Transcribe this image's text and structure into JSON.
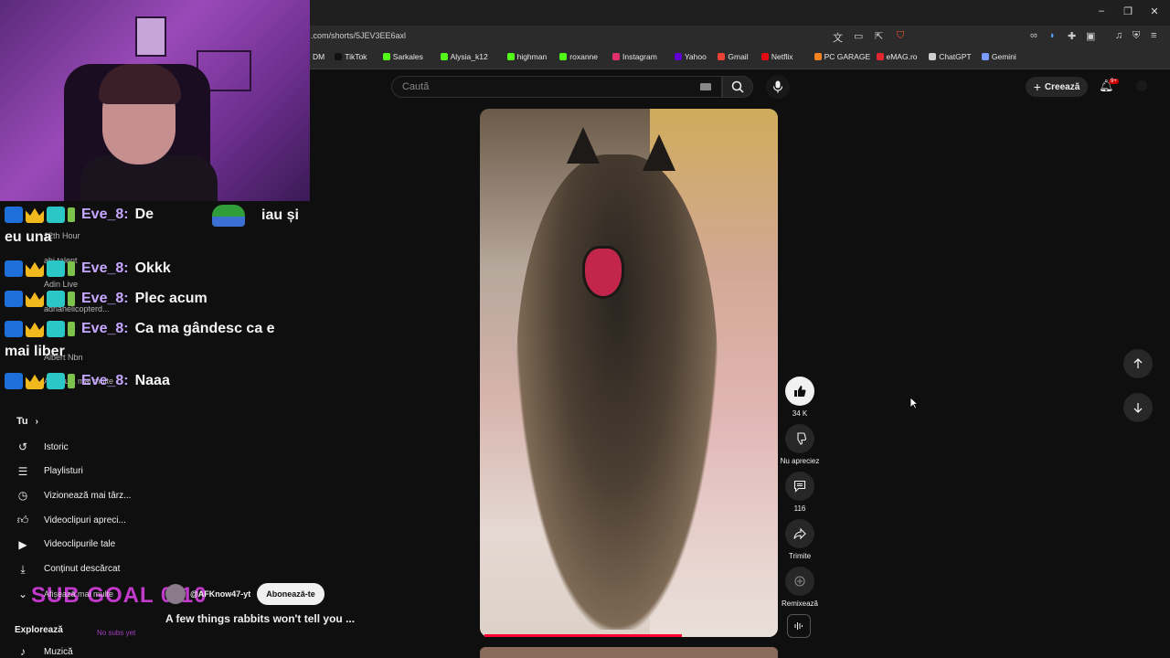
{
  "browser": {
    "url": ".com/shorts/5JEV3EE6axl",
    "bookmarks": [
      {
        "label": "DM",
        "color": "#2b2b2b"
      },
      {
        "label": "TikTok",
        "color": "#111111"
      },
      {
        "label": "Sarkales",
        "color": "#53fc18"
      },
      {
        "label": "Alysia_k12",
        "color": "#53fc18"
      },
      {
        "label": "highman",
        "color": "#53fc18"
      },
      {
        "label": "roxanne",
        "color": "#53fc18"
      },
      {
        "label": "Instagram",
        "color": "#e1306c"
      },
      {
        "label": "Yahoo",
        "color": "#6001d2"
      },
      {
        "label": "Gmail",
        "color": "#ea4335"
      },
      {
        "label": "Netflix",
        "color": "#e50914"
      },
      {
        "label": "PC GARAGE",
        "color": "#f58220"
      },
      {
        "label": "eMAG.ro",
        "color": "#e3262f"
      },
      {
        "label": "ChatGPT",
        "color": "#cfcfcf"
      },
      {
        "label": "Gemini",
        "color": "#7b9cff"
      }
    ]
  },
  "youtube": {
    "search_placeholder": "Caută",
    "create_label": "Creează",
    "notif_badge": "9+"
  },
  "chat": {
    "messages": [
      {
        "user": "Eve_8:",
        "text": "De",
        "text2": "iau și",
        "wrap": "eu una"
      },
      {
        "user": "Eve_8:",
        "text": "Okkk"
      },
      {
        "user": "Eve_8:",
        "text": "Plec acum"
      },
      {
        "user": "Eve_8:",
        "text": "Ca ma gândesc ca e",
        "wrap": "mai liber"
      },
      {
        "user": "Eve_8:",
        "text": "Naaa"
      }
    ],
    "ghost_items": [
      "12th Hour",
      "abi talent",
      "Adin Live",
      "adriahelicopterd...",
      "Albert Nbn",
      "Afișează mai multe"
    ]
  },
  "sidebar": {
    "section_you": "Tu",
    "items": [
      {
        "label": "Istoric",
        "icon": "history-icon"
      },
      {
        "label": "Playlisturi",
        "icon": "playlist-icon"
      },
      {
        "label": "Vizionează mai târz...",
        "icon": "watch-later-icon"
      },
      {
        "label": "Videoclipuri apreci...",
        "icon": "liked-icon"
      },
      {
        "label": "Videoclipurile tale",
        "icon": "your-videos-icon"
      },
      {
        "label": "Conținut descărcat",
        "icon": "download-icon"
      }
    ],
    "show_more": "Afișează mai multe",
    "section_explore": "Explorează",
    "explore_items": [
      {
        "label": "Muzică",
        "icon": "music-icon"
      }
    ]
  },
  "overlay": {
    "sub_goal": "SUB GOAL 0/10",
    "not_subs": "No subs yet"
  },
  "short": {
    "channel": "@AFKnow47-yt",
    "subscribe_label": "Abonează-te",
    "title": "A few things rabbits won't tell you ...",
    "likes": "34 K",
    "dislike_label": "Nu apreciez",
    "comments": "116",
    "share_label": "Trimite",
    "remix_label": "Remixează"
  },
  "colors": {
    "accent_red": "#ff0033",
    "chat_username": "#c7a7ff",
    "sub_goal": "#d63fe0"
  }
}
